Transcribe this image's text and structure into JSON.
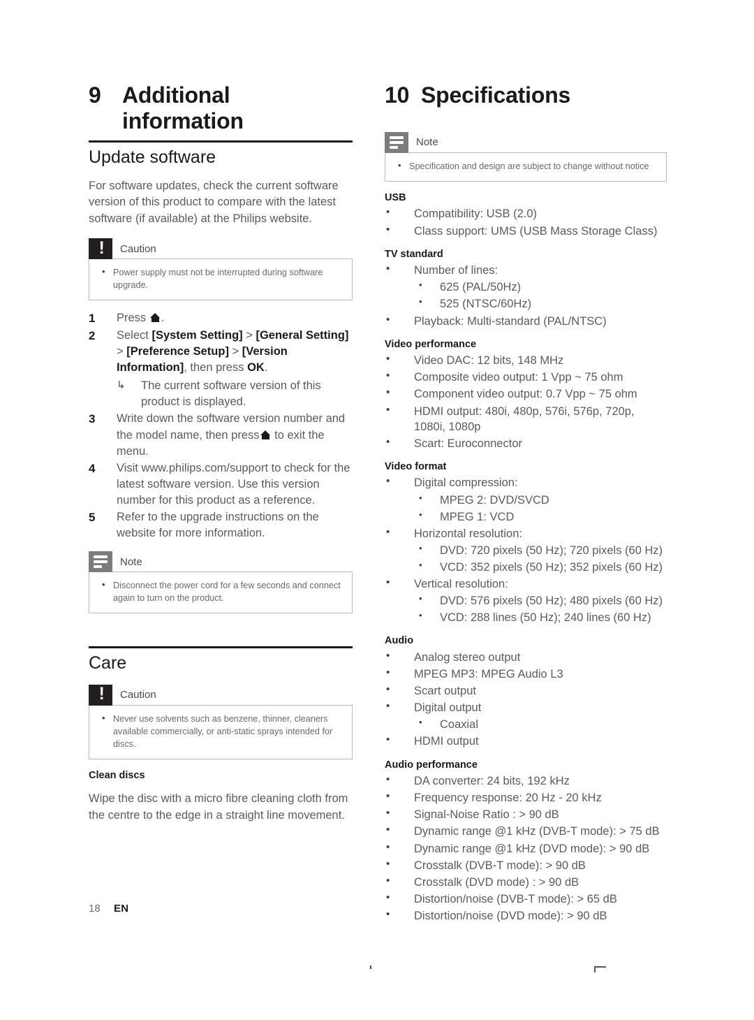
{
  "page": {
    "number": "18",
    "language": "EN"
  },
  "left_column": {
    "chapter": {
      "number": "9",
      "title": "Additional information"
    },
    "section_update": {
      "heading": "Update software",
      "intro": "For software updates, check the current software version of this product to compare with the latest software (if available) at the Philips website.",
      "caution": {
        "label": "Caution",
        "items": [
          "Power supply must not be interrupted during software upgrade."
        ]
      },
      "steps": [
        {
          "n": "1",
          "text_html": "Press <span class=\"home-glyph\"></span>."
        },
        {
          "n": "2",
          "text_html": "Select <b>[System Setting]</b> <span class=\"gt\">&gt;</span> <b>[General Setting]</b> <span class=\"gt\">&gt;</span> <b>[Preference Setup]</b> <span class=\"gt\">&gt;</span> <b>[Version Information]</b>, then press <b>OK</b>.",
          "result": "The current software version of this product is displayed."
        },
        {
          "n": "3",
          "text_html": "Write down the software version number and the model name, then press<span class=\"home-glyph\"></span> to exit the menu."
        },
        {
          "n": "4",
          "text_html": "Visit www.philips.com/support to check for the latest software version. Use this version number for this product as a reference."
        },
        {
          "n": "5",
          "text_html": "Refer to the upgrade instructions on the website for more information."
        }
      ],
      "note": {
        "label": "Note",
        "items": [
          "Disconnect the power cord for a few seconds and connect again to turn on the product."
        ]
      }
    },
    "section_care": {
      "heading": "Care",
      "caution": {
        "label": "Caution",
        "items": [
          "Never use solvents such as benzene, thinner, cleaners available commercially, or anti-static sprays intended for discs."
        ]
      },
      "subheading": "Clean discs",
      "paragraph": "Wipe the disc with a micro fibre cleaning cloth from the centre to the edge in a straight line movement."
    }
  },
  "right_column": {
    "chapter": {
      "number": "10",
      "title": "Specifications"
    },
    "note": {
      "label": "Note",
      "items": [
        "Specification and design are subject to change without notice"
      ]
    },
    "groups": [
      {
        "title": "USB",
        "items": [
          {
            "text": "Compatibility: USB (2.0)"
          },
          {
            "text": "Class support: UMS (USB Mass Storage Class)"
          }
        ]
      },
      {
        "title": "TV standard",
        "items": [
          {
            "text": "Number of lines:",
            "children": [
              {
                "text": "625 (PAL/50Hz)"
              },
              {
                "text": "525 (NTSC/60Hz)"
              }
            ]
          },
          {
            "text": "Playback: Multi-standard (PAL/NTSC)"
          }
        ]
      },
      {
        "title": "Video performance",
        "items": [
          {
            "text": "Video DAC: 12 bits, 148 MHz"
          },
          {
            "text": "Composite video output: 1 Vpp ~ 75 ohm"
          },
          {
            "text": "Component video output: 0.7 Vpp ~ 75 ohm"
          },
          {
            "text": "HDMI output: 480i, 480p, 576i, 576p, 720p, 1080i, 1080p"
          },
          {
            "text": "Scart: Euroconnector"
          }
        ]
      },
      {
        "title": "Video format",
        "items": [
          {
            "text": "Digital compression:",
            "children": [
              {
                "text": "MPEG 2: DVD/SVCD"
              },
              {
                "text": "MPEG 1: VCD"
              }
            ]
          },
          {
            "text": "Horizontal resolution:",
            "children": [
              {
                "text": "DVD: 720 pixels (50 Hz); 720 pixels (60 Hz)"
              },
              {
                "text": "VCD: 352 pixels (50 Hz); 352 pixels (60 Hz)"
              }
            ]
          },
          {
            "text": "Vertical resolution:",
            "children": [
              {
                "text": "DVD: 576 pixels (50 Hz); 480 pixels (60 Hz)"
              },
              {
                "text": "VCD: 288 lines (50 Hz); 240 lines (60 Hz)"
              }
            ]
          }
        ]
      },
      {
        "title": "Audio",
        "items": [
          {
            "text": "Analog stereo output"
          },
          {
            "text": "MPEG MP3: MPEG Audio L3"
          },
          {
            "text": "Scart output"
          },
          {
            "text": "Digital output",
            "children": [
              {
                "text": "Coaxial"
              }
            ]
          },
          {
            "text": "HDMI output"
          }
        ]
      },
      {
        "title": "Audio performance",
        "items": [
          {
            "text": "DA converter: 24 bits, 192 kHz"
          },
          {
            "text": "Frequency response: 20 Hz - 20 kHz"
          },
          {
            "text": "Signal-Noise Ratio : > 90 dB"
          },
          {
            "text": "Dynamic range @1 kHz (DVB-T mode): > 75 dB"
          },
          {
            "text": "Dynamic range @1 kHz (DVD mode): > 90 dB"
          },
          {
            "text": "Crosstalk (DVB-T mode): > 90 dB"
          },
          {
            "text": "Crosstalk (DVD mode) : > 90 dB"
          },
          {
            "text": "Distortion/noise (DVB-T mode): > 65 dB"
          },
          {
            "text": "Distortion/noise (DVD mode): > 90 dB"
          }
        ]
      }
    ]
  },
  "icons": {
    "caution": "exclamation-icon",
    "note": "lines-icon",
    "home": "home-icon",
    "result_arrow": "result-arrow-icon"
  }
}
